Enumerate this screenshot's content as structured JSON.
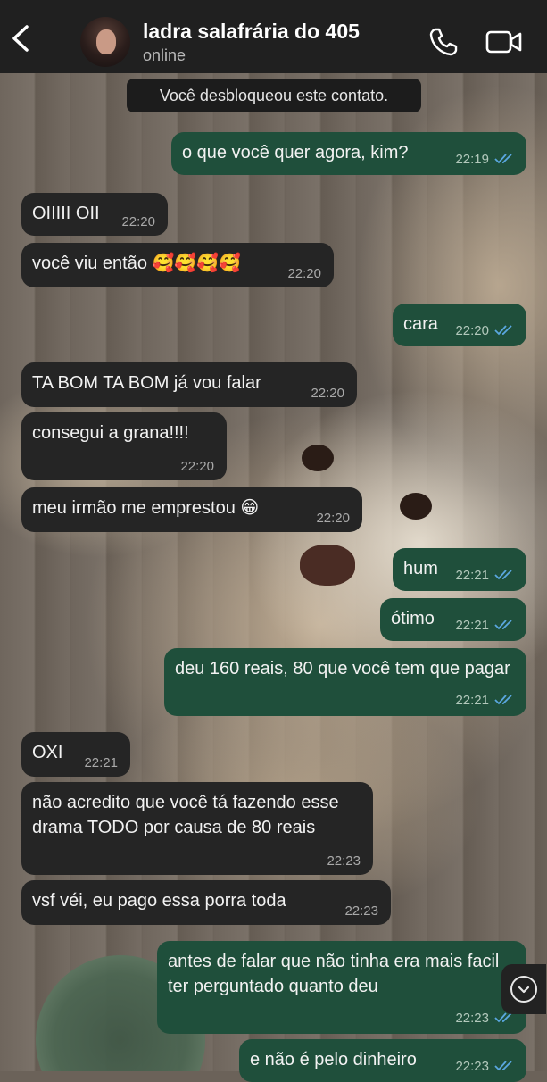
{
  "header": {
    "back_icon": "chevron-left-icon",
    "contact_name": "ladra salafrária do 405",
    "status": "online",
    "call_icon": "phone-icon",
    "video_icon": "video-camera-icon"
  },
  "notice": "Você desbloqueou este contato.",
  "messages": [
    {
      "dir": "out",
      "text": "o que você quer agora, kim?",
      "time": "22:19",
      "read": true
    },
    {
      "dir": "in",
      "text": "OIIIII OII",
      "time": "22:20"
    },
    {
      "dir": "in",
      "text": "você viu então 🥰🥰🥰🥰",
      "time": "22:20"
    },
    {
      "dir": "out",
      "text": "cara",
      "time": "22:20",
      "read": true
    },
    {
      "dir": "in",
      "text": "TA BOM TA BOM já vou falar",
      "time": "22:20"
    },
    {
      "dir": "in",
      "text": "consegui a grana!!!!",
      "time": "22:20"
    },
    {
      "dir": "in",
      "text": "meu irmão me emprestou 😁",
      "time": "22:20"
    },
    {
      "dir": "out",
      "text": "hum",
      "time": "22:21",
      "read": true
    },
    {
      "dir": "out",
      "text": "ótimo",
      "time": "22:21",
      "read": true
    },
    {
      "dir": "out",
      "text": "deu 160 reais, 80 que você tem que pagar",
      "time": "22:21",
      "read": true
    },
    {
      "dir": "in",
      "text": "OXI",
      "time": "22:21"
    },
    {
      "dir": "in",
      "text": "não acredito que você tá fazendo esse drama TODO por causa de 80 reais",
      "time": "22:23"
    },
    {
      "dir": "in",
      "text": "vsf véi, eu pago essa porra toda",
      "time": "22:23"
    },
    {
      "dir": "out",
      "text": "antes de falar que não tinha era mais facil ter perguntado quanto deu",
      "time": "22:23",
      "read": true
    },
    {
      "dir": "out",
      "text": "e não é pelo dinheiro",
      "time": "22:23",
      "read": true
    }
  ],
  "scroll_down_icon": "chevron-down-circle-icon",
  "colors": {
    "incoming_bubble": "#252525",
    "outgoing_bubble": "#1f4f3b",
    "read_ticks": "#5aa7e0",
    "header_bg": "#202020"
  }
}
